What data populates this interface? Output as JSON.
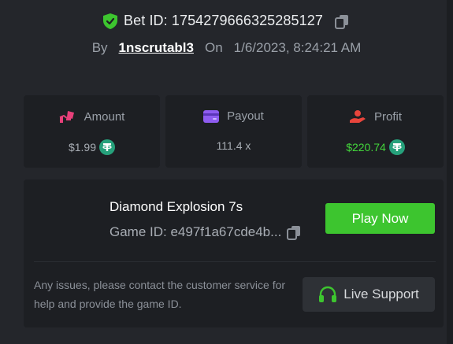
{
  "bet": {
    "bet_id_label": "Bet ID: 1754279666325285127",
    "by_label": "By",
    "username": "1nscrutabl3",
    "on_label": "On",
    "timestamp": "1/6/2023, 8:24:21 AM"
  },
  "stats": {
    "amount": {
      "label": "Amount",
      "value": "$1.99",
      "icon": "amount-hand-icon",
      "color": "#e8407a"
    },
    "payout": {
      "label": "Payout",
      "value": "111.4 x",
      "icon": "wallet-card-icon",
      "color": "#8e5cf0"
    },
    "profit": {
      "label": "Profit",
      "value": "$220.74",
      "icon": "profit-hand-icon",
      "color": "#e8453c",
      "value_color": "#43d63b"
    }
  },
  "game": {
    "title": "Diamond Explosion 7s",
    "game_id": "Game ID: e497f1a67cde4b...",
    "play_label": "Play Now",
    "notice": "Any issues, please contact the customer service for help and provide the game ID.",
    "support_label": "Live Support"
  },
  "colors": {
    "background": "#24262b",
    "card": "#1d1f23",
    "accent_green": "#3dc52f",
    "tether": "#26a17b"
  }
}
